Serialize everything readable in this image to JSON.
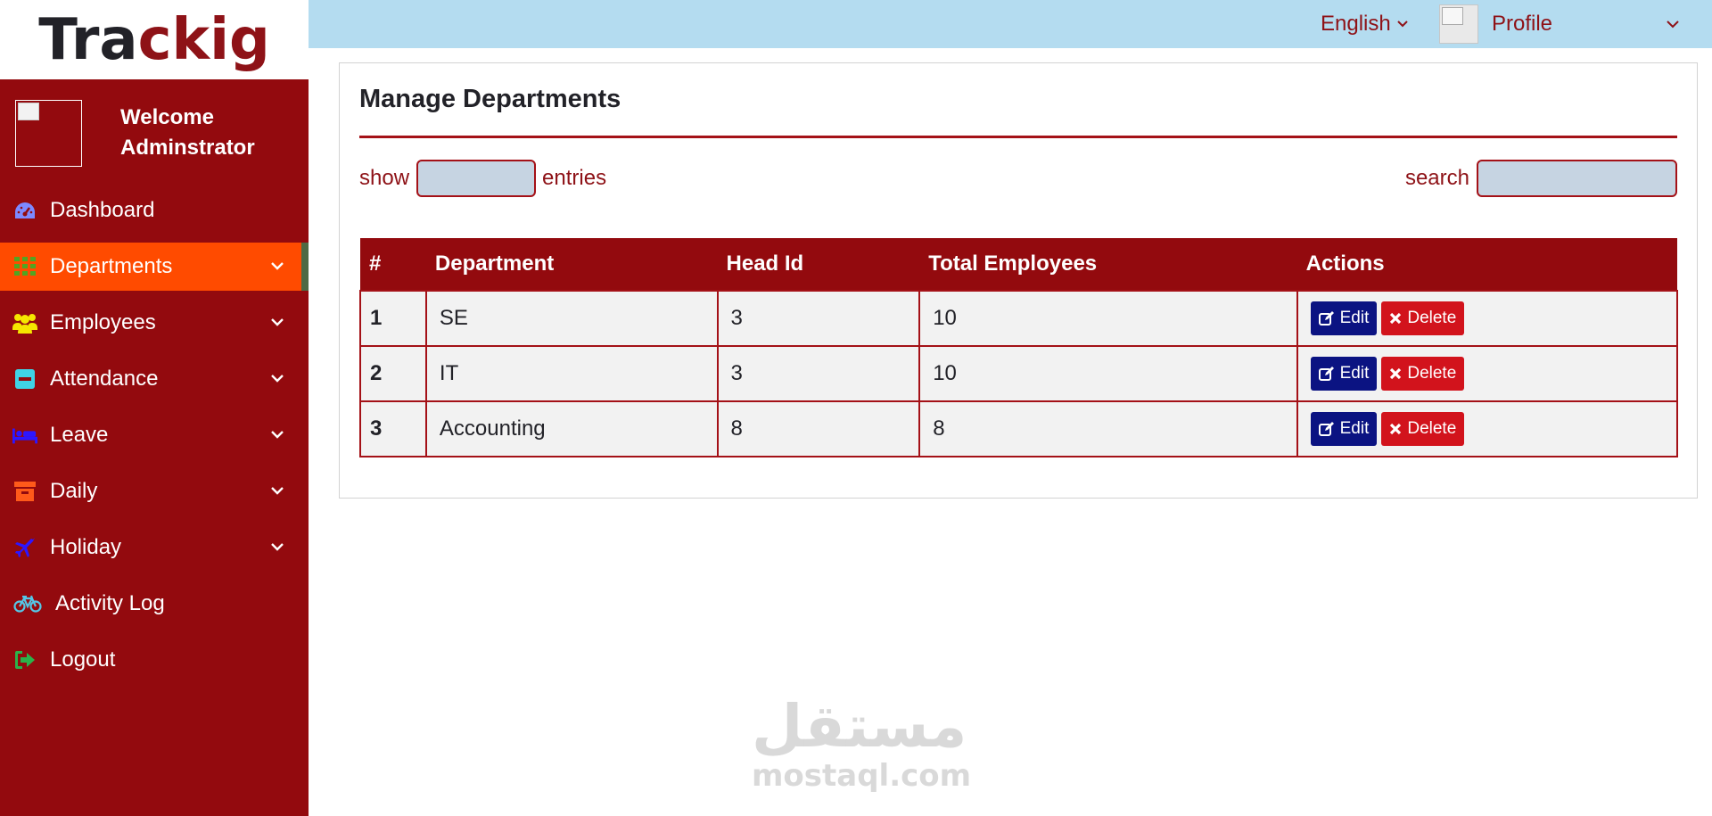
{
  "logo": {
    "part1": "Tra",
    "part2": "ckig"
  },
  "welcome": {
    "line1": "Welcome",
    "line2": "Adminstrator"
  },
  "sidebar": {
    "items": [
      {
        "label": "Dashboard",
        "icon": "dashboard-icon",
        "icon_color": "#7d89ff",
        "has_submenu": false,
        "active": false
      },
      {
        "label": "Departments",
        "icon": "grid-icon",
        "icon_color": "#51a522",
        "has_submenu": true,
        "active": true
      },
      {
        "label": "Employees",
        "icon": "users-icon",
        "icon_color": "#f5e600",
        "has_submenu": true,
        "active": false
      },
      {
        "label": "Attendance",
        "icon": "minus-square-icon",
        "icon_color": "#3fd3e6",
        "has_submenu": true,
        "active": false
      },
      {
        "label": "Leave",
        "icon": "bed-icon",
        "icon_color": "#2d16ff",
        "has_submenu": true,
        "active": false
      },
      {
        "label": "Daily",
        "icon": "archive-icon",
        "icon_color": "#ff5a1a",
        "has_submenu": true,
        "active": false
      },
      {
        "label": "Holiday",
        "icon": "plane-icon",
        "icon_color": "#2d16ff",
        "has_submenu": true,
        "active": false
      },
      {
        "label": "Activity Log",
        "icon": "bicycle-icon",
        "icon_color": "#55c7e6",
        "has_submenu": false,
        "active": false
      },
      {
        "label": "Logout",
        "icon": "sign-out-icon",
        "icon_color": "#2bb24a",
        "has_submenu": false,
        "active": false
      }
    ]
  },
  "topbar": {
    "language": "English",
    "profile": "Profile"
  },
  "panel": {
    "title": "Manage Departments",
    "show_label": "show",
    "entries_label": "entries",
    "search_label": "search",
    "entries_value": "",
    "search_value": ""
  },
  "table": {
    "headers": [
      "#",
      "Department",
      "Head Id",
      "Total Employees",
      "Actions"
    ],
    "rows": [
      {
        "num": "1",
        "department": "SE",
        "head_id": "3",
        "total": "10"
      },
      {
        "num": "2",
        "department": "IT",
        "head_id": "3",
        "total": "10"
      },
      {
        "num": "3",
        "department": "Accounting",
        "head_id": "8",
        "total": "8"
      }
    ],
    "edit_label": "Edit",
    "delete_label": "Delete"
  },
  "watermark": {
    "arabic": "مستقل",
    "latin": "mostaql.com"
  },
  "colors": {
    "sidebar_bg": "#930a0e",
    "active_item": "#ff4b00",
    "topbar_bg": "#b4dcf0",
    "brand_red": "#8e1217",
    "edit_btn": "#0b1382",
    "delete_btn": "#d2131c"
  }
}
